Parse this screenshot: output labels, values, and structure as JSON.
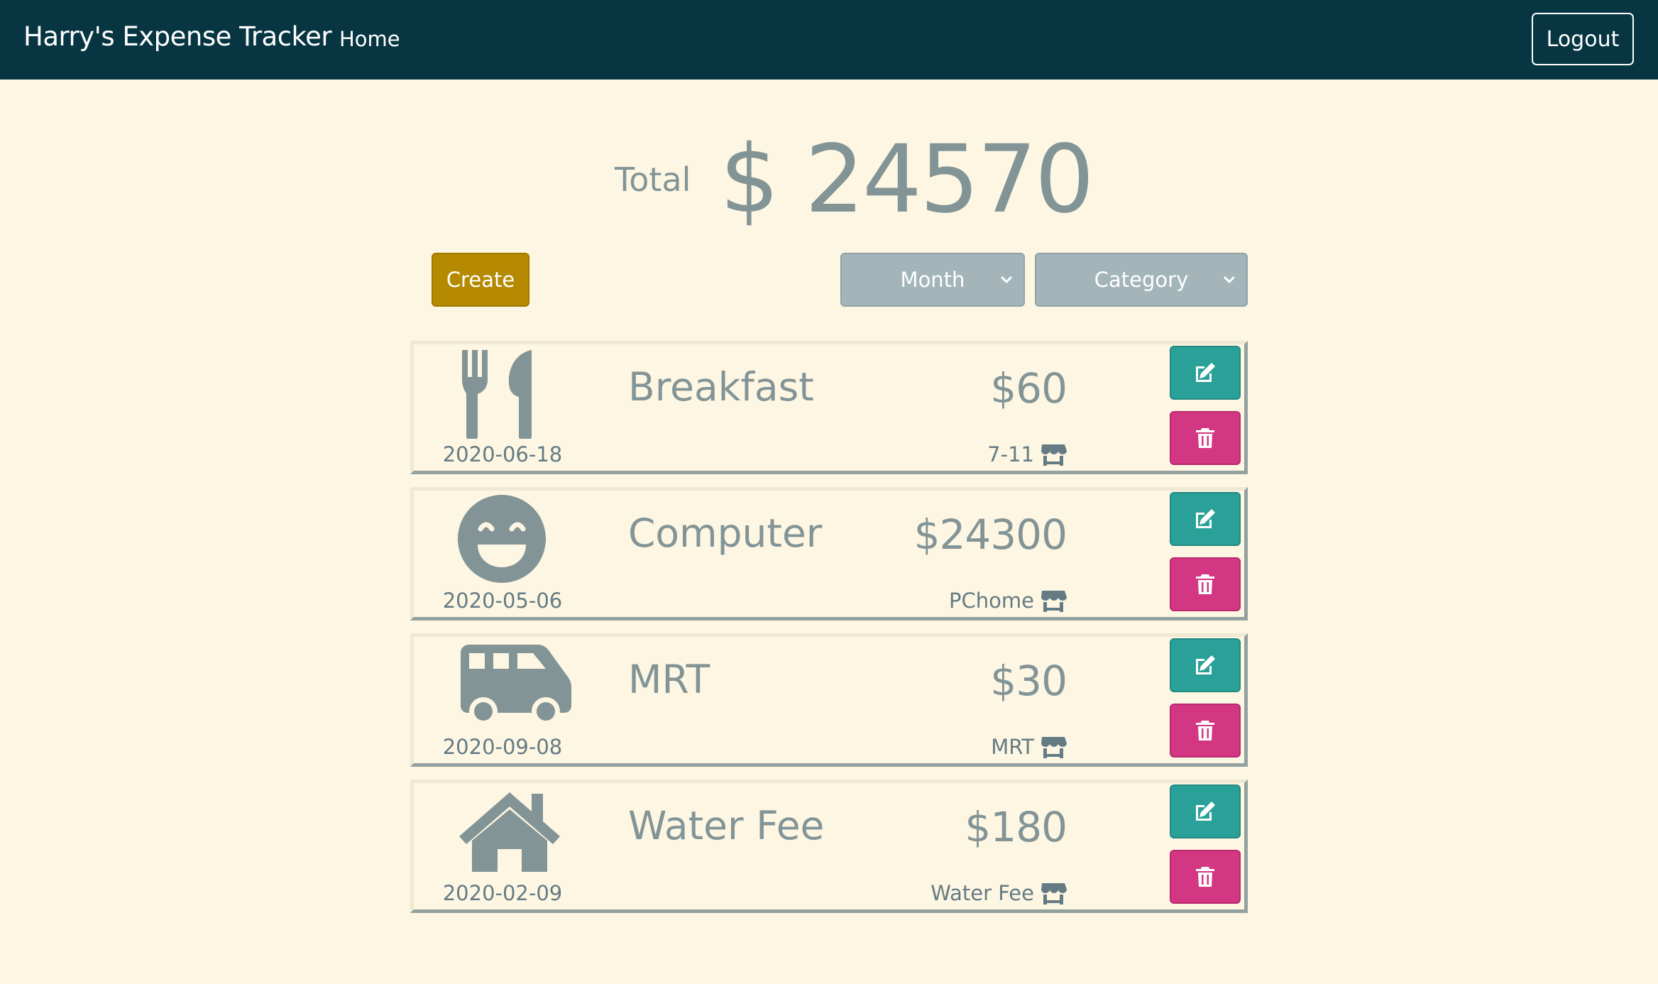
{
  "nav": {
    "brand": "Harry's Expense Tracker",
    "home_label": "Home",
    "logout_label": "Logout"
  },
  "summary": {
    "total_label": "Total",
    "total_amount": "$ 24570"
  },
  "toolbar": {
    "create_label": "Create",
    "month_filter": "Month",
    "category_filter": "Category"
  },
  "records": [
    {
      "icon": "utensils-icon",
      "date": "2020-06-18",
      "name": "Breakfast",
      "amount": "$60",
      "merchant": "7-11"
    },
    {
      "icon": "smile-icon",
      "date": "2020-05-06",
      "name": "Computer",
      "amount": "$24300",
      "merchant": "PChome"
    },
    {
      "icon": "bus-icon",
      "date": "2020-09-08",
      "name": "MRT",
      "amount": "$30",
      "merchant": "MRT"
    },
    {
      "icon": "home-icon",
      "date": "2020-02-09",
      "name": "Water Fee",
      "amount": "$180",
      "merchant": "Water Fee"
    }
  ],
  "colors": {
    "navbar": "#073642",
    "background": "#fdf6e3",
    "create_button": "#b58900",
    "edit_button": "#2aa198",
    "delete_button": "#d33682",
    "select": "#a3b5b9",
    "text_muted": "#839496"
  }
}
